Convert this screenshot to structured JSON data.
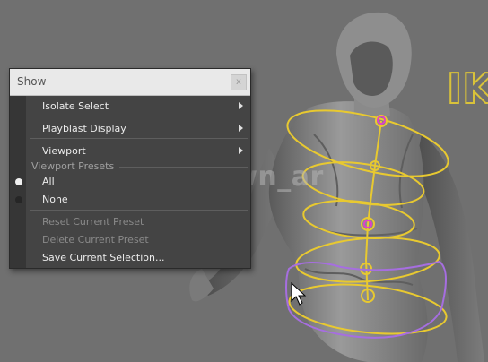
{
  "viewport": {
    "watermark": "@dawn_ar",
    "ik_label": "IK",
    "colors": {
      "background": "#6f6f6f",
      "rig_yellow": "#e8c930",
      "rig_purple": "#a66ee0",
      "joint_magenta": "#e040c8"
    }
  },
  "menu": {
    "title": "Show",
    "close_label": "x",
    "items": [
      {
        "label": "Isolate Select",
        "has_submenu": true
      },
      {
        "label": "Playblast Display",
        "has_submenu": true
      },
      {
        "label": "Viewport",
        "has_submenu": true
      }
    ],
    "presets_section": "Viewport Presets",
    "presets": [
      {
        "label": "All",
        "selected": true
      },
      {
        "label": "None",
        "selected": false
      }
    ],
    "actions": [
      {
        "label": "Reset Current Preset",
        "enabled": false
      },
      {
        "label": "Delete Current Preset",
        "enabled": false
      },
      {
        "label": "Save Current Selection...",
        "enabled": true
      }
    ]
  }
}
